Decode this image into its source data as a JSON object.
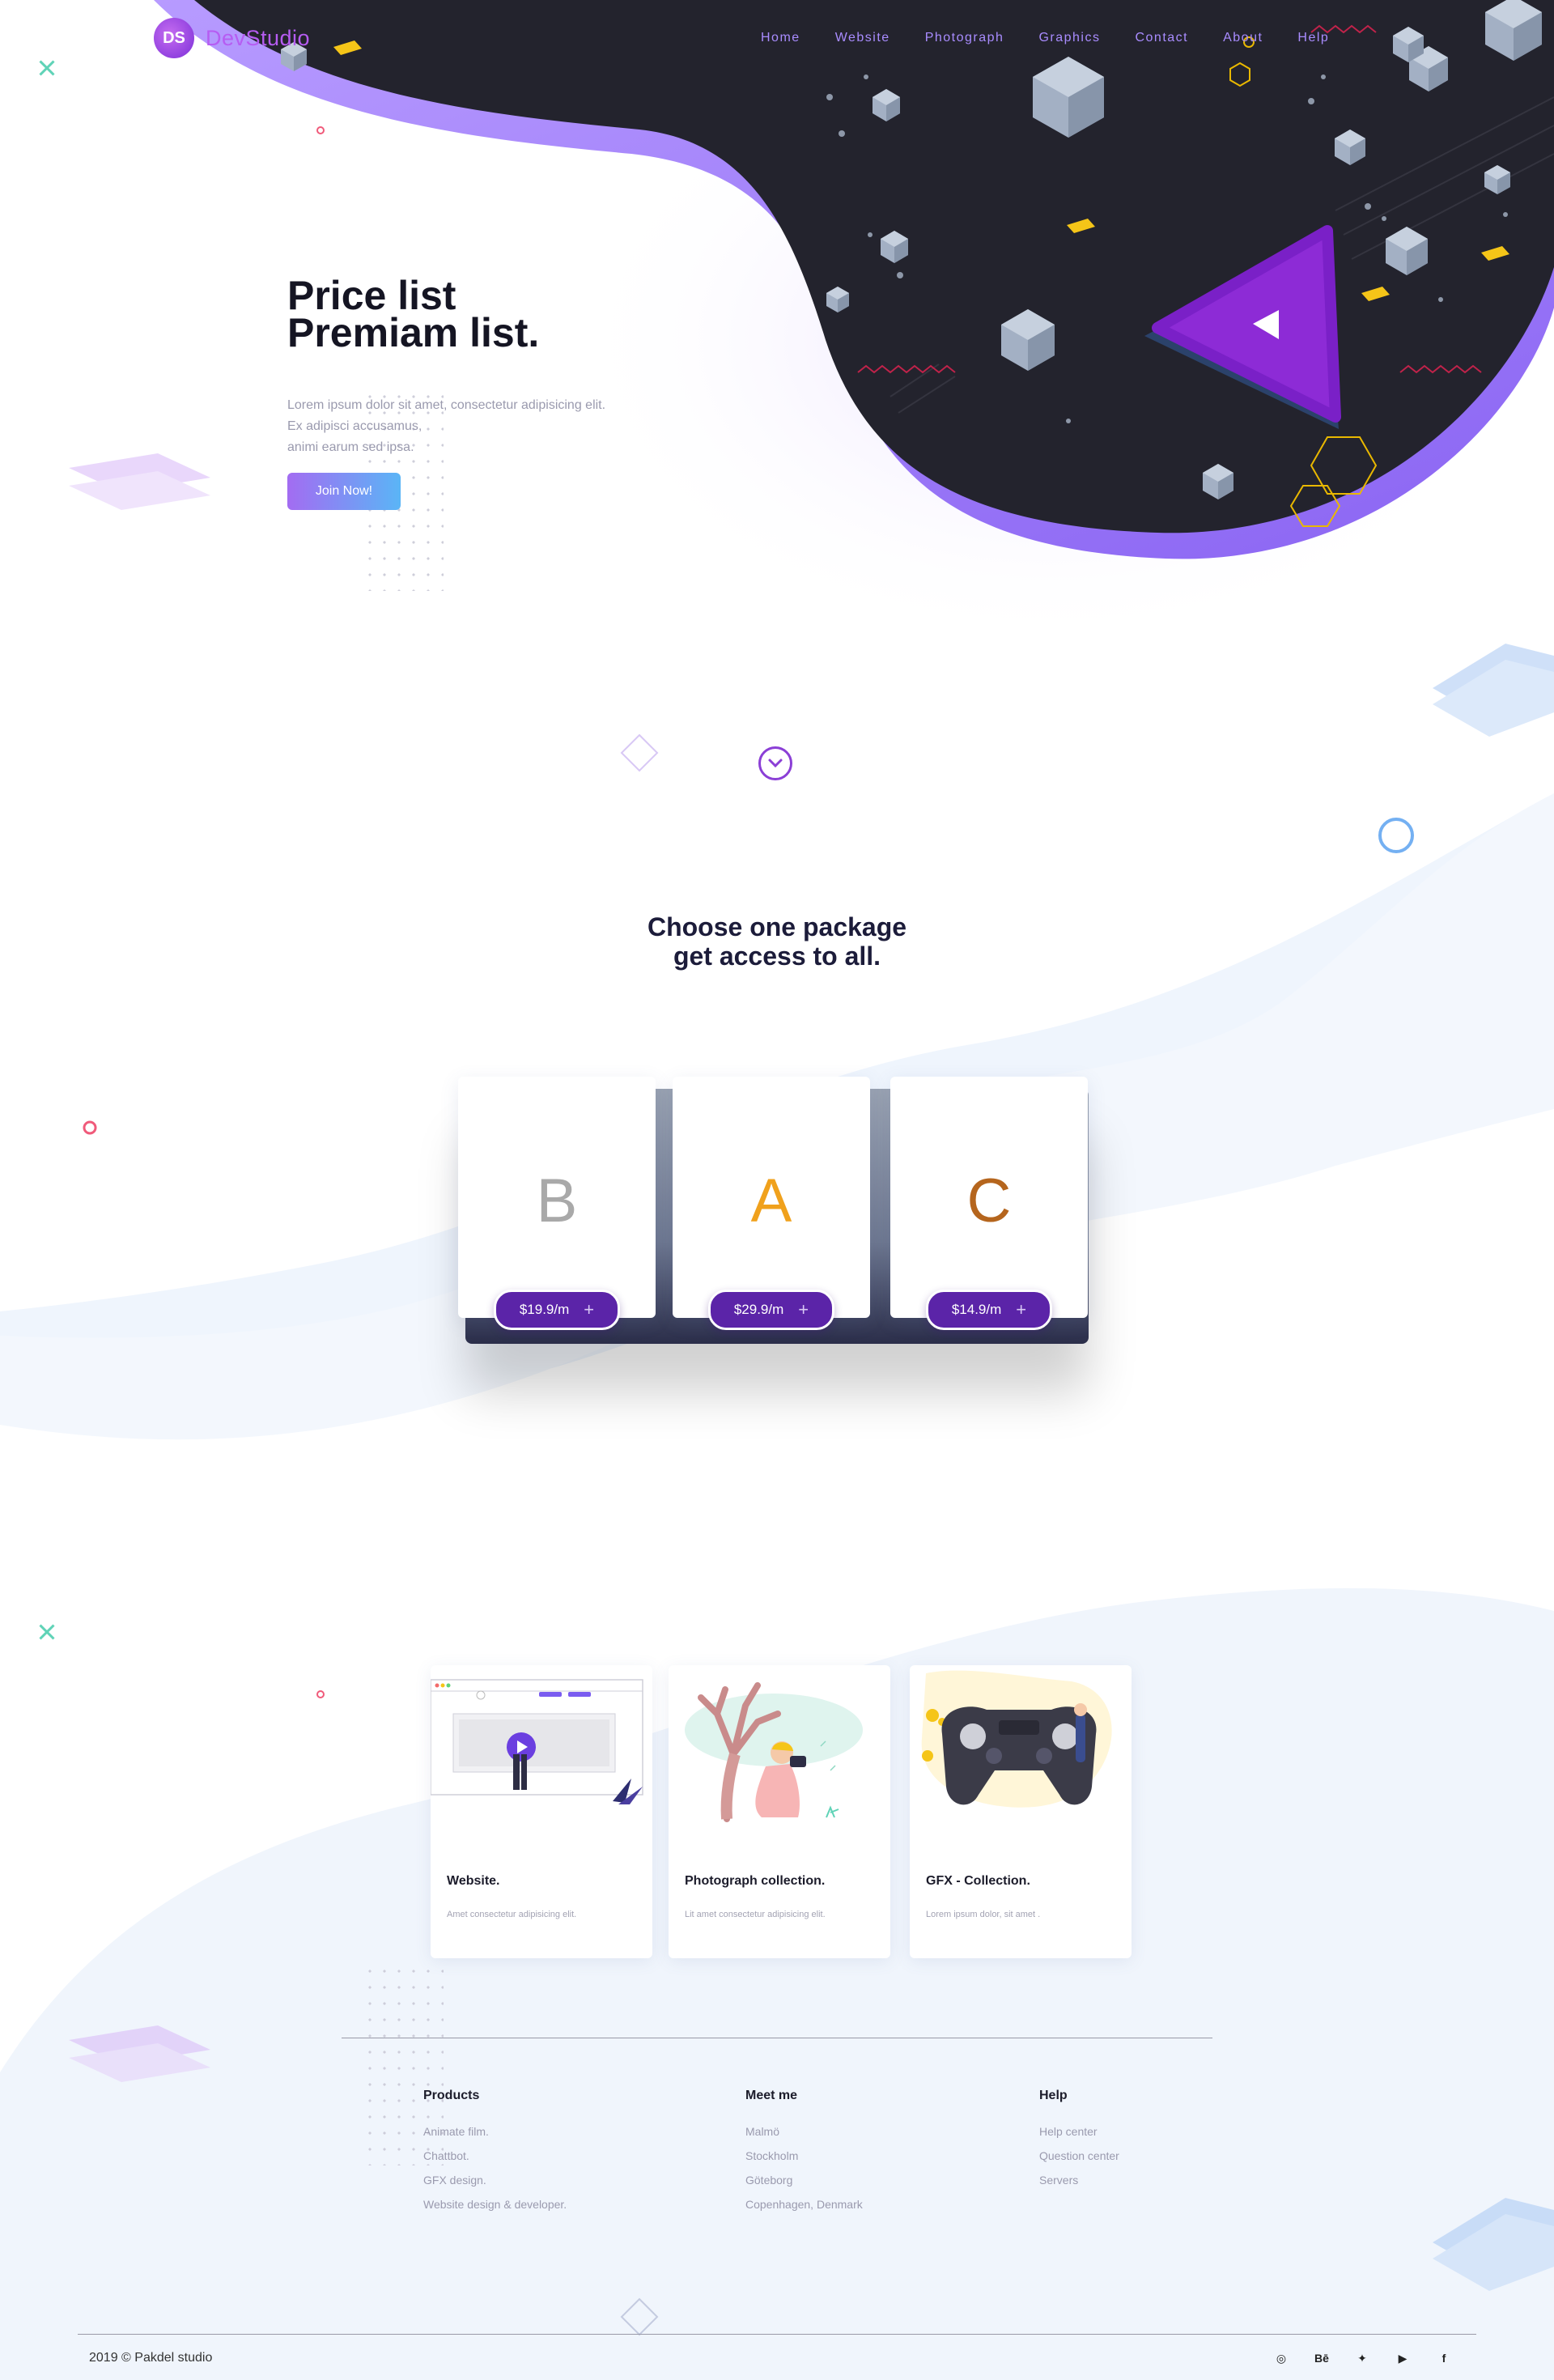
{
  "brand": {
    "name": "DevStudio",
    "logo_mark": "DS"
  },
  "nav": {
    "items": [
      "Home",
      "Website",
      "Photograph",
      "Graphics",
      "Contact",
      "About",
      "Help"
    ]
  },
  "hero": {
    "title_line1": "Price list",
    "title_line2": "Premiam list.",
    "desc_line1": "Lorem ipsum dolor sit amet, consectetur adipisicing elit.",
    "desc_line2": "Ex adipisci accusamus,",
    "desc_line3": "animi earum sed ipsa.",
    "cta": "Join Now!"
  },
  "packages": {
    "title_line1": "Choose one package",
    "title_line2": "get access to all.",
    "items": [
      {
        "letter": "B",
        "price": "$19.9/m",
        "color": "#a9a9a9"
      },
      {
        "letter": "A",
        "price": "$29.9/m",
        "color": "#f0a11c"
      },
      {
        "letter": "C",
        "price": "$14.9/m",
        "color": "#b5651d"
      }
    ],
    "plus": "+"
  },
  "services": [
    {
      "title": "Website.",
      "desc": "Amet consectetur adipisicing elit."
    },
    {
      "title": "Photograph collection.",
      "desc": "Lit amet consectetur adipisicing elit."
    },
    {
      "title": "GFX - Collection.",
      "desc": "Lorem ipsum dolor, sit amet ."
    }
  ],
  "footer": {
    "columns": [
      {
        "heading": "Products",
        "links": [
          "Animate film.",
          "Chattbot.",
          "GFX design.",
          "Website design & developer."
        ]
      },
      {
        "heading": "Meet me",
        "links": [
          "Malmö",
          "Stockholm",
          "Göteborg",
          "Copenhagen, Denmark"
        ]
      },
      {
        "heading": "Help",
        "links": [
          "Help center",
          "Question center",
          "Servers"
        ]
      }
    ],
    "copyright": "2019 © Pakdel studio",
    "social": [
      "instagram-icon",
      "behance-icon",
      "twitter-icon",
      "youtube-icon",
      "facebook-icon"
    ],
    "social_glyphs": [
      "◎",
      "Bē",
      "✦",
      "▶",
      "f"
    ]
  },
  "colors": {
    "accent": "#8b3fd6",
    "dark_blob": "#23232d",
    "purple_rim": "#a07cf5"
  }
}
